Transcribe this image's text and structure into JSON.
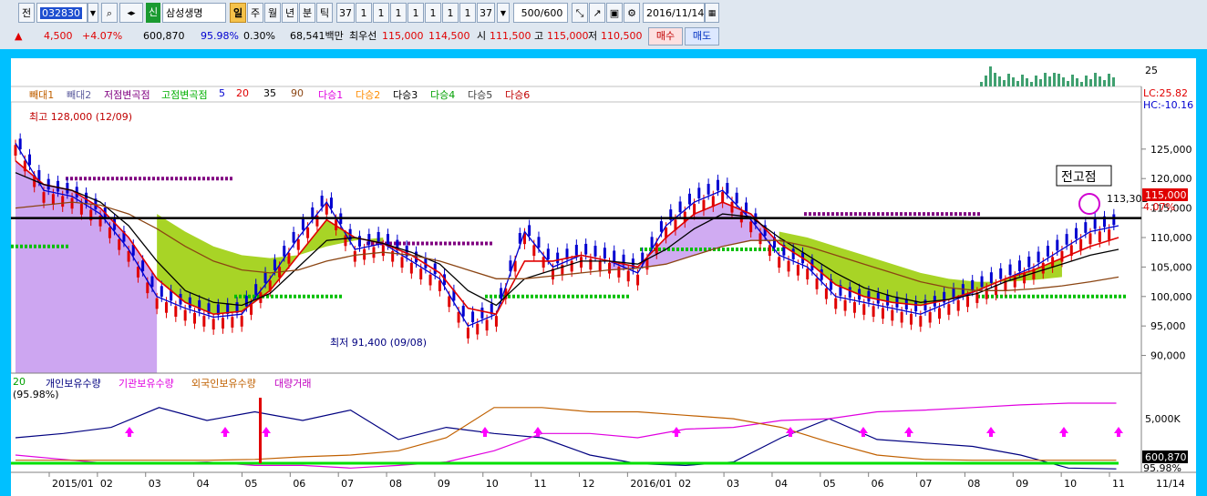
{
  "toolbar": {
    "period_label": "전",
    "code_value": "032830",
    "credit_badge": "신",
    "stock_name": "삼성생명",
    "periods": [
      "일",
      "주",
      "월",
      "년",
      "분",
      "틱"
    ],
    "active_period": "일",
    "num_boxes": [
      "37",
      "1",
      "1",
      "1",
      "1",
      "1",
      "1",
      "1",
      "37"
    ],
    "count_value": "500/600",
    "date_value": "2016/11/14"
  },
  "quote": {
    "change": "4,500",
    "change_pct": "+4.07%",
    "volume": "600,870",
    "vol_ratio": "95.98%",
    "turnover": "0.30%",
    "amount": "68,541백만",
    "best_ask_label": "최우선",
    "best_ask": "115,000",
    "best_bid": "114,500",
    "open_label": "시",
    "open": "111,500",
    "high_label": "고",
    "high": "115,000",
    "low_label": "저",
    "low": "110,500",
    "buy_label": "매수",
    "sell_label": "매도"
  },
  "legend_main": [
    {
      "text": "빼대1",
      "color": "#c06000"
    },
    {
      "text": "빼대2",
      "color": "#6060a0"
    },
    {
      "text": "저점변곡점",
      "color": "#800080"
    },
    {
      "text": "고점변곡점",
      "color": "#00b000"
    },
    {
      "text": "5",
      "color": "#0000d0"
    },
    {
      "text": "20",
      "color": "#e00000"
    },
    {
      "text": "35",
      "color": "#000000"
    },
    {
      "text": "90",
      "color": "#8b4513"
    },
    {
      "text": "다승1",
      "color": "#e000e0"
    },
    {
      "text": "다승2",
      "color": "#ff8c00"
    },
    {
      "text": "다승3",
      "color": "#000000"
    },
    {
      "text": "다승4",
      "color": "#00a000"
    },
    {
      "text": "다승5",
      "color": "#404040"
    },
    {
      "text": "다승6",
      "color": "#c00000"
    }
  ],
  "legend_lower": [
    {
      "text": "20",
      "color": "#00a000"
    },
    {
      "text": "개인보유수량",
      "color": "#000080"
    },
    {
      "text": "기관보유수량",
      "color": "#e000e0"
    },
    {
      "text": "외국인보유수량",
      "color": "#c06000"
    },
    {
      "text": "대량거래",
      "color": "#c000c0"
    }
  ],
  "lower_ratio": "(95.98%)",
  "annotations": {
    "high_label": "최고 128,000 (12/09)",
    "low_label": "최저 91,400 (09/08)",
    "prev_high_label": "전고점",
    "level_label": "113,302",
    "current_price_tag": "115,000",
    "pct_tag": "4.07%",
    "lc_label": "LC:25.82",
    "hc_label": "HC:-10.16",
    "vol_right_label": "25",
    "lower_axis_label": "5,000K",
    "lower_value_tag": "600,870",
    "lower_pct_tag": "95.98%",
    "last_date_label": "11/14"
  },
  "colors": {
    "up": "#e00000",
    "down": "#0000d0",
    "cloud_green": "#99cc00",
    "cloud_purple": "#c89cf0",
    "frame": "#00c0ff"
  },
  "chart_data": {
    "type": "line",
    "title": "",
    "xlabel": "",
    "ylabel": "",
    "ylim": [
      87000,
      133000
    ],
    "y_ticks": [
      "90,000",
      "95,000",
      "100,000",
      "105,000",
      "110,000",
      "115,000",
      "120,000",
      "125,000"
    ],
    "x_ticks": [
      "2015/01",
      "02",
      "03",
      "04",
      "05",
      "06",
      "07",
      "08",
      "09",
      "10",
      "11",
      "12",
      "2016/01",
      "02",
      "03",
      "04",
      "05",
      "06",
      "07",
      "08",
      "09",
      "10",
      "11"
    ],
    "horizontal_line": 113302,
    "series": [
      {
        "name": "5",
        "values": [
          126000,
          118000,
          117000,
          114000,
          108000,
          100000,
          98000,
          96500,
          97000,
          103000,
          110000,
          116000,
          108000,
          109000,
          106000,
          103000,
          95000,
          97000,
          111000,
          105000,
          107000,
          106000,
          104000,
          112000,
          116000,
          118000,
          113000,
          107000,
          105000,
          100000,
          99000,
          98000,
          97000,
          99000,
          101000,
          103000,
          105000,
          108000,
          111000,
          112000
        ]
      },
      {
        "name": "20",
        "values": [
          123000,
          119000,
          118000,
          115000,
          110000,
          103000,
          99000,
          97000,
          97500,
          101000,
          107000,
          113000,
          110000,
          109000,
          107000,
          104000,
          98000,
          97000,
          106000,
          106000,
          107000,
          106000,
          105000,
          110000,
          114000,
          116000,
          114000,
          109000,
          106000,
          102000,
          100000,
          99000,
          98500,
          99500,
          101000,
          103000,
          104500,
          106500,
          108500,
          110000
        ]
      },
      {
        "name": "35",
        "values": [
          121000,
          119000,
          118000,
          116000,
          112000,
          106000,
          101000,
          99000,
          98500,
          100500,
          105000,
          109500,
          110000,
          109000,
          107500,
          105500,
          101000,
          98500,
          103000,
          104500,
          106000,
          106000,
          105500,
          108000,
          111500,
          114000,
          113500,
          110000,
          107000,
          104000,
          101500,
          100000,
          99000,
          99500,
          100500,
          102500,
          104000,
          105500,
          107000,
          108000
        ]
      },
      {
        "name": "90",
        "values": [
          115000,
          115500,
          116000,
          115500,
          114000,
          111500,
          108500,
          106000,
          104500,
          104000,
          104500,
          106000,
          107000,
          107500,
          107000,
          106000,
          104500,
          103000,
          103000,
          103500,
          104000,
          104500,
          104800,
          105500,
          107000,
          108500,
          109500,
          109500,
          108500,
          107000,
          105500,
          104000,
          102500,
          101500,
          101000,
          101000,
          101300,
          101800,
          102500,
          103300
        ]
      }
    ],
    "annotations_points": {
      "high": 128000,
      "low": 91400,
      "last_close": 115000
    }
  }
}
